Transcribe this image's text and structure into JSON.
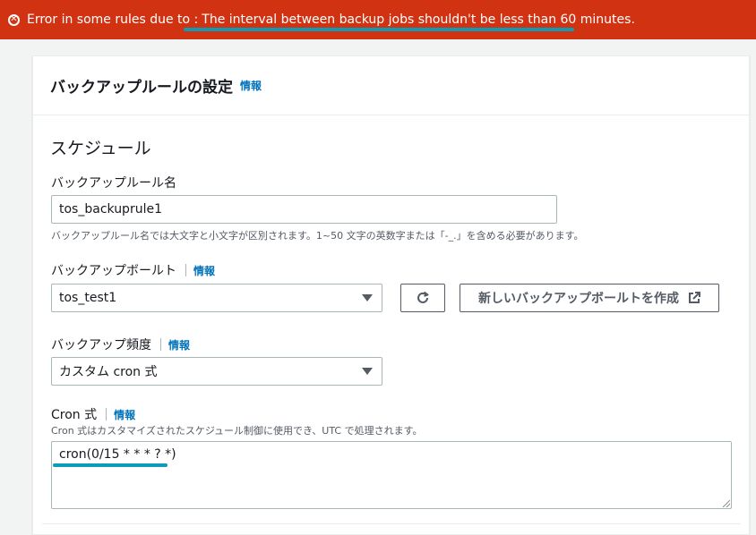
{
  "error_banner": {
    "prefix": "Error in some rules due to :",
    "message": "The interval between backup jobs shouldn't be less than 60 minutes.",
    "icon": "error-circle-x-icon",
    "color": "#d13212"
  },
  "card": {
    "title": "バックアップルールの設定",
    "info": "情報"
  },
  "schedule": {
    "section_title": "スケジュール",
    "rule_name": {
      "label": "バックアップルール名",
      "value": "tos_backuprule1",
      "hint": "バックアップルール名では大文字と小文字が区別されます。1~50 文字の英数字または「-_.」を含める必要があります。"
    },
    "vault": {
      "label": "バックアップボールト",
      "info": "情報",
      "value": "tos_test1",
      "refresh_icon": "refresh-icon",
      "create_button": "新しいバックアップボールトを作成",
      "external_icon": "external-link-icon"
    },
    "frequency": {
      "label": "バックアップ頻度",
      "info": "情報",
      "value": "カスタム cron 式"
    },
    "cron": {
      "label": "Cron 式",
      "info": "情報",
      "hint": "Cron 式はカスタマイズされたスケジュール制御に使用でき、UTC で処理されます。",
      "value": "cron(0/15 * * * ? *)"
    }
  },
  "colors": {
    "link": "#0073bb",
    "annotation_underline": "#0d9bb8"
  }
}
